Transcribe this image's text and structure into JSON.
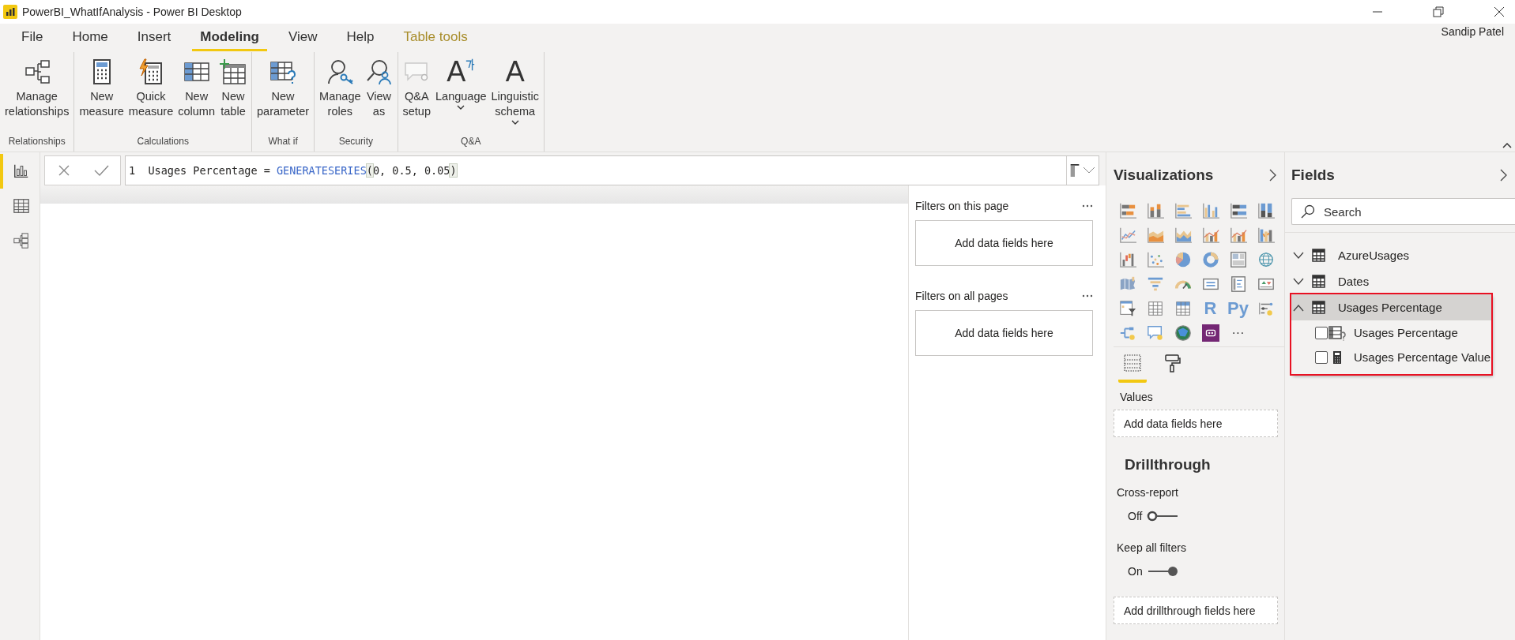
{
  "window": {
    "title": "PowerBI_WhatIfAnalysis - Power BI Desktop",
    "user": "Sandip Patel"
  },
  "ribbon": {
    "tabs": [
      {
        "label": "File",
        "kind": "standard",
        "selected": false
      },
      {
        "label": "Home",
        "kind": "standard",
        "selected": false
      },
      {
        "label": "Insert",
        "kind": "standard",
        "selected": false
      },
      {
        "label": "Modeling",
        "kind": "standard",
        "selected": true
      },
      {
        "label": "View",
        "kind": "standard",
        "selected": false
      },
      {
        "label": "Help",
        "kind": "standard",
        "selected": false
      },
      {
        "label": "Table tools",
        "kind": "contextual",
        "selected": false
      }
    ],
    "groups": [
      {
        "label": "Relationships",
        "buttons": [
          {
            "label": "Manage\nrelationships",
            "kind": "relationships",
            "dropdown": false,
            "disabled": false
          }
        ]
      },
      {
        "label": "Calculations",
        "buttons": [
          {
            "label": "New\nmeasure",
            "kind": "calculator",
            "dropdown": false,
            "disabled": false
          },
          {
            "label": "Quick\nmeasure",
            "kind": "quick-calculator",
            "dropdown": false,
            "disabled": false
          },
          {
            "label": "New\ncolumn",
            "kind": "column",
            "dropdown": false,
            "disabled": false
          },
          {
            "label": "New\ntable",
            "kind": "table",
            "dropdown": false,
            "disabled": false
          }
        ]
      },
      {
        "label": "What if",
        "buttons": [
          {
            "label": "New\nparameter",
            "kind": "parameter",
            "dropdown": false,
            "disabled": false
          }
        ]
      },
      {
        "label": "Security",
        "buttons": [
          {
            "label": "Manage\nroles",
            "kind": "roles",
            "dropdown": false,
            "disabled": false
          },
          {
            "label": "View\nas",
            "kind": "view-as",
            "dropdown": false,
            "disabled": false
          }
        ]
      },
      {
        "label": "Q&A",
        "buttons": [
          {
            "label": "Q&A\nsetup",
            "kind": "qa",
            "dropdown": false,
            "disabled": true
          },
          {
            "label": "Language",
            "kind": "language",
            "glyph": "A",
            "dropdown": true,
            "disabled": false
          },
          {
            "label": "Linguistic\nschema",
            "kind": "linguistic",
            "glyph": "A",
            "dropdown": true,
            "disabled": false
          }
        ]
      }
    ]
  },
  "left_nav": [
    {
      "kind": "report",
      "selected": true
    },
    {
      "kind": "data",
      "selected": false
    },
    {
      "kind": "model",
      "selected": false
    }
  ],
  "formula_bar": {
    "line_number": "1",
    "before": "Usages Percentage = ",
    "function": "GENERATESERIES",
    "open": "(",
    "args": "0, 0.5, 0.05",
    "close": ")"
  },
  "filters": [
    {
      "title": "Filters on this page",
      "well": "Add data fields here"
    },
    {
      "title": "Filters on all pages",
      "well": "Add data fields here"
    }
  ],
  "visualizations": {
    "title": "Visualizations",
    "gallery": [
      {
        "kind": "hbar-stacked"
      },
      {
        "kind": "bar-stacked"
      },
      {
        "kind": "hbar-clustered"
      },
      {
        "kind": "bar-clustered"
      },
      {
        "kind": "hbar-100"
      },
      {
        "kind": "bar-100"
      },
      {
        "kind": "line"
      },
      {
        "kind": "area"
      },
      {
        "kind": "area-stacked"
      },
      {
        "kind": "line-bar"
      },
      {
        "kind": "line-bar"
      },
      {
        "kind": "ribbon"
      },
      {
        "kind": "waterfall"
      },
      {
        "kind": "scatter"
      },
      {
        "kind": "pie"
      },
      {
        "kind": "donut"
      },
      {
        "kind": "treemap"
      },
      {
        "kind": "globe"
      },
      {
        "kind": "filled-map"
      },
      {
        "kind": "funnel"
      },
      {
        "kind": "gauge"
      },
      {
        "kind": "card"
      },
      {
        "kind": "multi-card"
      },
      {
        "kind": "kpi"
      },
      {
        "kind": "slicer"
      },
      {
        "kind": "table"
      },
      {
        "kind": "matrix"
      },
      {
        "kind": "glyph",
        "glyph": "R"
      },
      {
        "kind": "glyph",
        "glyph": "Py"
      },
      {
        "kind": "influencers"
      },
      {
        "kind": "decomposition"
      },
      {
        "kind": "qa"
      },
      {
        "kind": "arcgis"
      },
      {
        "kind": "custom"
      },
      {
        "kind": "glyph",
        "glyph": "···"
      }
    ],
    "tabs": [
      {
        "kind": "fields",
        "selected": true
      },
      {
        "kind": "format",
        "selected": false
      }
    ],
    "values_label": "Values",
    "values_well": "Add data fields here",
    "drillthrough": {
      "title": "Drillthrough",
      "toggles": [
        {
          "label": "Cross-report",
          "state_text": "Off",
          "on": false
        },
        {
          "label": "Keep all filters",
          "state_text": "On",
          "on": true
        }
      ],
      "well": "Add drillthrough fields here"
    }
  },
  "fields": {
    "title": "Fields",
    "search": {
      "placeholder": "Search"
    },
    "tables": [
      {
        "name": "AzureUsages",
        "expanded": false,
        "selected": false,
        "outlined": false
      },
      {
        "name": "Dates",
        "expanded": false,
        "selected": false,
        "outlined": false
      },
      {
        "name": "Usages Percentage",
        "expanded": true,
        "selected": true,
        "outlined": true,
        "children": [
          {
            "name": "Usages Percentage",
            "kind": "parameter",
            "checked": false
          },
          {
            "name": "Usages Percentage Value",
            "kind": "measure",
            "checked": false
          }
        ]
      }
    ]
  }
}
